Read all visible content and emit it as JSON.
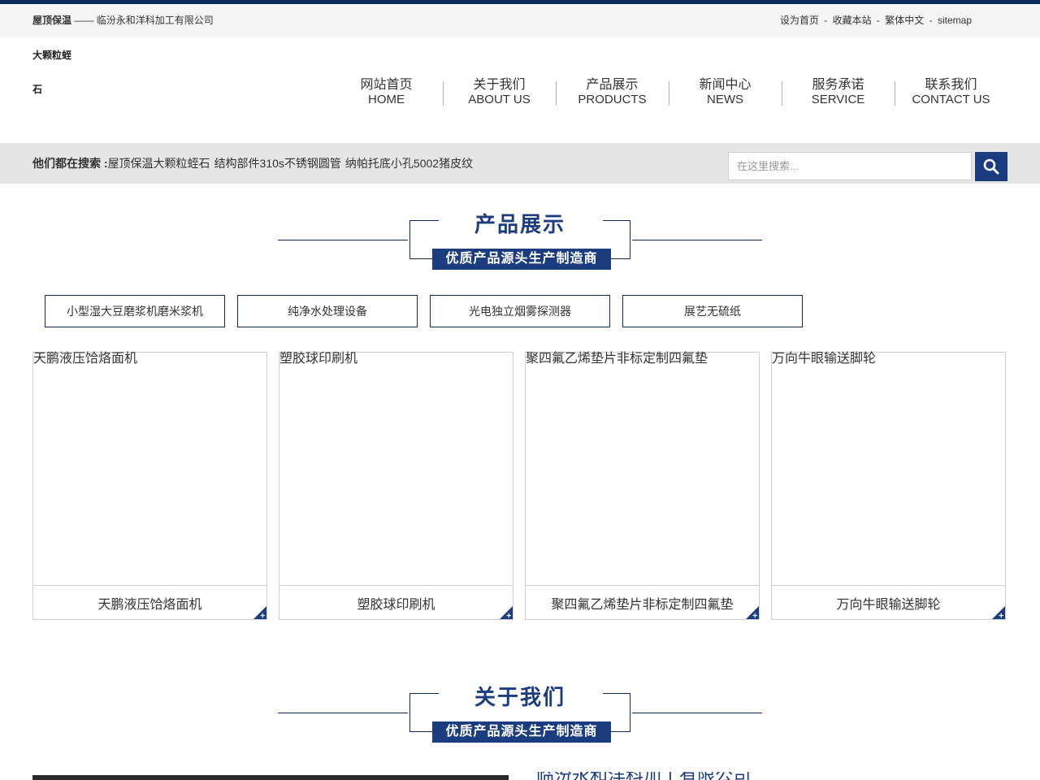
{
  "topbar": {
    "brand": "屋顶保温",
    "dash": "——",
    "company": "临汾永和洋科加工有限公司",
    "links": [
      "设为首页",
      "收藏本站",
      "繁体中文",
      "sitemap"
    ],
    "sep": "-"
  },
  "logo": {
    "line1": "大颗粒蛭",
    "line2": "石"
  },
  "nav": [
    {
      "cn": "网站首页",
      "en": "HOME"
    },
    {
      "cn": "关于我们",
      "en": "ABOUT US"
    },
    {
      "cn": "产品展示",
      "en": "PRODUCTS"
    },
    {
      "cn": "新闻中心",
      "en": "NEWS"
    },
    {
      "cn": "服务承诺",
      "en": "SERVICE"
    },
    {
      "cn": "联系我们",
      "en": "CONTACT US"
    }
  ],
  "search": {
    "hot_label": "他们都在搜索 :",
    "keywords": [
      "屋顶保温大颗粒蛭石",
      "结构部件310s不锈钢圆管",
      "纳帕托底小孔5002猪皮纹"
    ],
    "placeholder": "在这里搜索..."
  },
  "products_section": {
    "title": "产品展示",
    "subtitle": "优质产品源头生产制造商"
  },
  "categories": [
    "小型湿大豆磨浆机磨米浆机",
    "纯净水处理设备",
    "光电独立烟雾探测器",
    "展艺无硫纸"
  ],
  "products": [
    {
      "alt": "天鹏液压饸烙面机",
      "name": "天鹏液压饸烙面机"
    },
    {
      "alt": "塑胶球印刷机",
      "name": "塑胶球印刷机"
    },
    {
      "alt": "聚四氟乙烯垫片非标定制四氟垫",
      "name": "聚四氟乙烯垫片非标定制四氟垫"
    },
    {
      "alt": "万向牛眼输送脚轮",
      "name": "万向牛眼输送脚轮"
    }
  ],
  "about_section": {
    "title": "关于我们",
    "subtitle": "优质产品源头生产制造商",
    "company_name": "临汾永和洋科加工有限公司"
  },
  "colors": {
    "brand": "#1b3d80",
    "dark": "#0d2a5a",
    "search_bg": "#e6e6e6"
  }
}
